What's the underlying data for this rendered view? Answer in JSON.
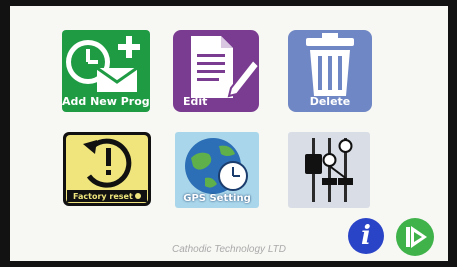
{
  "tiles": {
    "add_new_program": {
      "label": "Add New Prog.",
      "icon": "clock-envelope-plus-icon"
    },
    "edit": {
      "label": "Edit",
      "icon": "document-pencil-icon"
    },
    "delete": {
      "label": "Delete",
      "icon": "trash-icon"
    },
    "factory_reset": {
      "label": "Factory reset",
      "icon": "clock-undo-icon"
    },
    "gps_setting": {
      "label": "GPS Setting",
      "icon": "globe-clock-icon"
    },
    "settings": {
      "icon": "sliders-icon"
    }
  },
  "buttons": {
    "info": {
      "label": "i",
      "icon": "info-icon"
    },
    "next": {
      "icon": "play-next-icon"
    }
  },
  "footer": {
    "text": "Cathodic Technology LTD"
  },
  "colors": {
    "green": "#1f9b44",
    "purple": "#7a3c90",
    "blue": "#6f87c4",
    "yellow": "#efe57c",
    "info_blue": "#2a44c8",
    "play_green": "#3fb24a"
  }
}
